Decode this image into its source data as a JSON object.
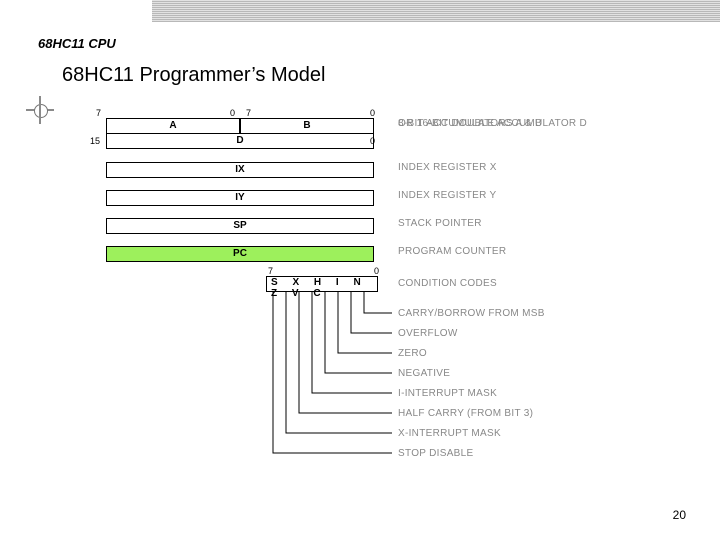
{
  "section": "68HC11 CPU",
  "title": "68HC11 Programmer’s Model",
  "page_number": "20",
  "registers": {
    "a": {
      "label": "A",
      "hi": "7",
      "lo": "0"
    },
    "b": {
      "label": "B",
      "hi": "7",
      "lo": "0"
    },
    "d": {
      "label": "D",
      "hi": "15",
      "lo": "0"
    },
    "ix": {
      "label": "IX"
    },
    "iy": {
      "label": "IY"
    },
    "sp": {
      "label": "SP"
    },
    "pc": {
      "label": "PC"
    }
  },
  "descs": {
    "ab": "8-BIT ACCUMULATORS A & B",
    "d": "OR 16-BIT DOUBLE ACCUMULATOR D",
    "ix": "INDEX REGISTER X",
    "iy": "INDEX REGISTER Y",
    "sp": "STACK POINTER",
    "pc": "PROGRAM COUNTER",
    "cc": "CONDITION CODES"
  },
  "ccr": {
    "hi": "7",
    "lo": "0",
    "bits": "S X H I N Z V C"
  },
  "flags": {
    "c": "CARRY/BORROW FROM MSB",
    "v": "OVERFLOW",
    "z": "ZERO",
    "n": "NEGATIVE",
    "i": "I-INTERRUPT MASK",
    "h": "HALF CARRY (FROM BIT 3)",
    "x": "X-INTERRUPT MASK",
    "s": "STOP DISABLE"
  }
}
